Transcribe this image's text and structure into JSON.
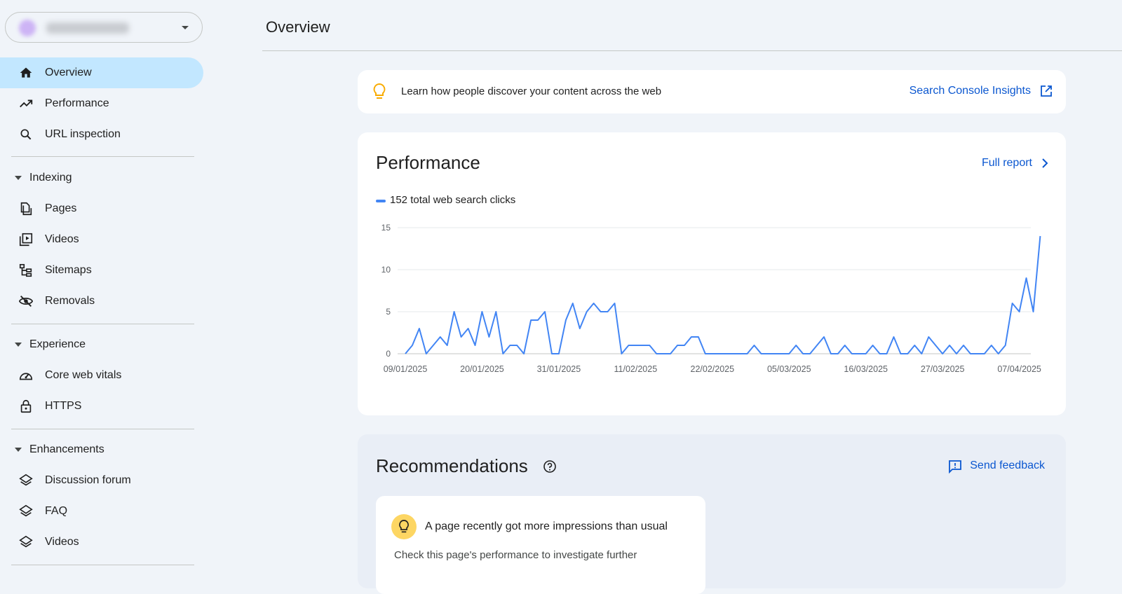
{
  "page": {
    "title": "Overview"
  },
  "sidebar": {
    "items_top": [
      {
        "label": "Overview",
        "icon": "home-icon"
      },
      {
        "label": "Performance",
        "icon": "trending-up-icon"
      },
      {
        "label": "URL inspection",
        "icon": "search-icon"
      }
    ],
    "sections": [
      {
        "label": "Indexing",
        "items": [
          {
            "label": "Pages",
            "icon": "pages-icon"
          },
          {
            "label": "Videos",
            "icon": "video-library-icon"
          },
          {
            "label": "Sitemaps",
            "icon": "sitemap-icon"
          },
          {
            "label": "Removals",
            "icon": "eye-off-icon"
          }
        ]
      },
      {
        "label": "Experience",
        "items": [
          {
            "label": "Core web vitals",
            "icon": "speed-icon"
          },
          {
            "label": "HTTPS",
            "icon": "lock-icon"
          }
        ]
      },
      {
        "label": "Enhancements",
        "items": [
          {
            "label": "Discussion forum",
            "icon": "layers-icon"
          },
          {
            "label": "FAQ",
            "icon": "layers-icon"
          },
          {
            "label": "Videos",
            "icon": "layers-icon"
          }
        ]
      }
    ]
  },
  "banner": {
    "text": "Learn how people discover your content across the web",
    "link": "Search Console Insights"
  },
  "performance": {
    "title": "Performance",
    "full_report": "Full report",
    "legend": "152 total web search clicks"
  },
  "chart_data": {
    "type": "line",
    "series_label": "152 total web search clicks",
    "color": "#4285f4",
    "start_date": "09/01/2025",
    "x_ticks": [
      "09/01/2025",
      "20/01/2025",
      "31/01/2025",
      "11/02/2025",
      "22/02/2025",
      "05/03/2025",
      "16/03/2025",
      "27/03/2025",
      "07/04/2025"
    ],
    "y_ticks": [
      0,
      5,
      10,
      15
    ],
    "ylim": [
      0,
      15
    ],
    "grid": true,
    "values": [
      0,
      1,
      3,
      0,
      1,
      2,
      1,
      5,
      2,
      3,
      1,
      5,
      2,
      5,
      0,
      1,
      1,
      0,
      4,
      4,
      5,
      0,
      0,
      4,
      6,
      3,
      5,
      6,
      5,
      5,
      6,
      0,
      1,
      1,
      1,
      1,
      0,
      0,
      0,
      1,
      1,
      2,
      2,
      0,
      0,
      0,
      0,
      0,
      0,
      0,
      1,
      0,
      0,
      0,
      0,
      0,
      1,
      0,
      0,
      1,
      2,
      0,
      0,
      1,
      0,
      0,
      0,
      1,
      0,
      0,
      2,
      0,
      0,
      1,
      0,
      2,
      1,
      0,
      1,
      0,
      1,
      0,
      0,
      0,
      1,
      0,
      1,
      6,
      5,
      9,
      5,
      14
    ]
  },
  "recommendations": {
    "title": "Recommendations",
    "feedback": "Send feedback",
    "card": {
      "heading": "A page recently got more impressions than usual",
      "sub": "Check this page's performance to investigate further"
    }
  }
}
